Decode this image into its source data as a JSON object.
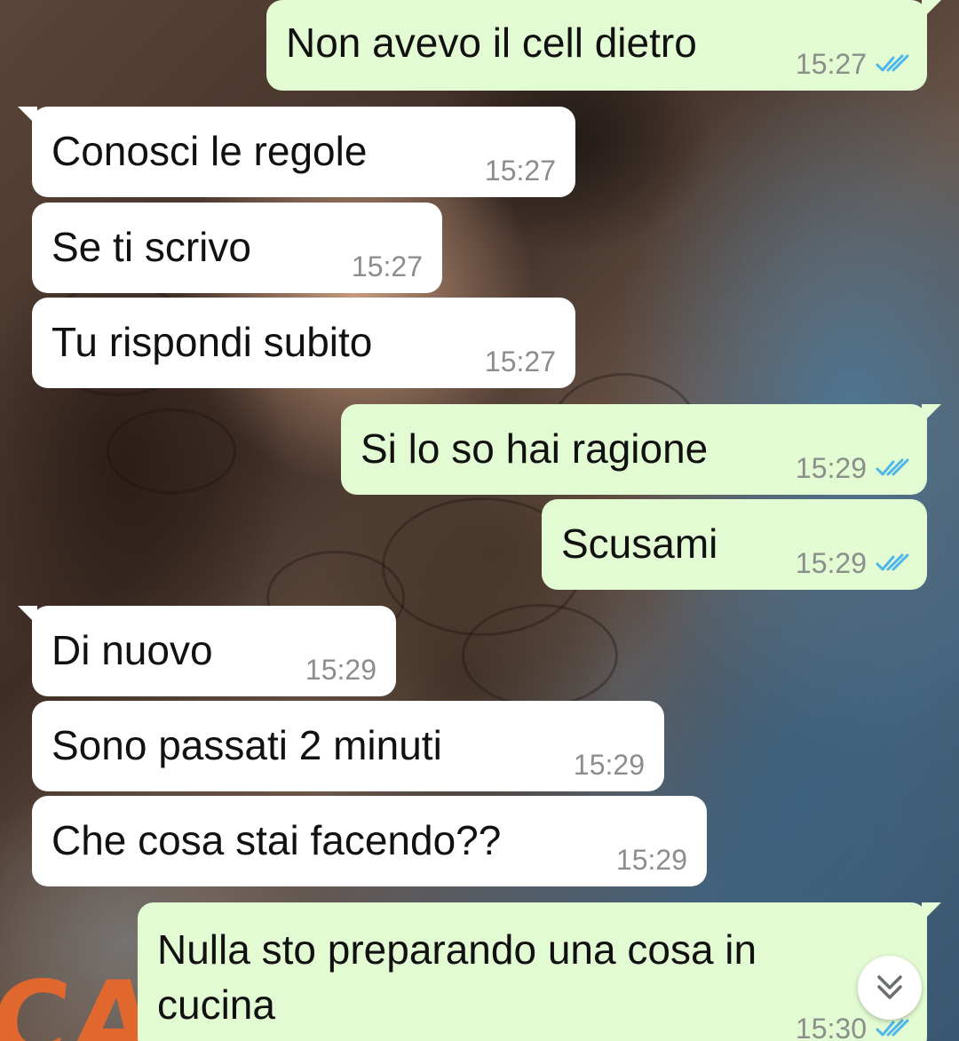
{
  "chat": {
    "messages": [
      {
        "text": "Non avevo il cell dietro",
        "time": "15:27",
        "direction": "outgoing",
        "status": "read"
      },
      {
        "text": "Conosci le regole",
        "time": "15:27",
        "direction": "incoming"
      },
      {
        "text": "Se ti scrivo",
        "time": "15:27",
        "direction": "incoming"
      },
      {
        "text": "Tu rispondi subito",
        "time": "15:27",
        "direction": "incoming"
      },
      {
        "text": "Si lo so hai ragione",
        "time": "15:29",
        "direction": "outgoing",
        "status": "read"
      },
      {
        "text": "Scusami",
        "time": "15:29",
        "direction": "outgoing",
        "status": "read"
      },
      {
        "text": "Di nuovo",
        "time": "15:29",
        "direction": "incoming"
      },
      {
        "text": "Sono passati 2 minuti",
        "time": "15:29",
        "direction": "incoming"
      },
      {
        "text": "Che cosa stai facendo??",
        "time": "15:29",
        "direction": "incoming"
      },
      {
        "text": "Nulla sto preparando una cosa in cucina",
        "time": "15:30",
        "direction": "outgoing",
        "status": "read"
      }
    ]
  },
  "icons": {
    "read_receipt": "double-check-icon",
    "scroll_down": "double-chevron-down-icon"
  },
  "colors": {
    "incoming_bubble": "#ffffff",
    "outgoing_bubble": "#e2fbd2",
    "read_tick": "#4fb6ec",
    "timestamp": "#8a8f8a"
  }
}
